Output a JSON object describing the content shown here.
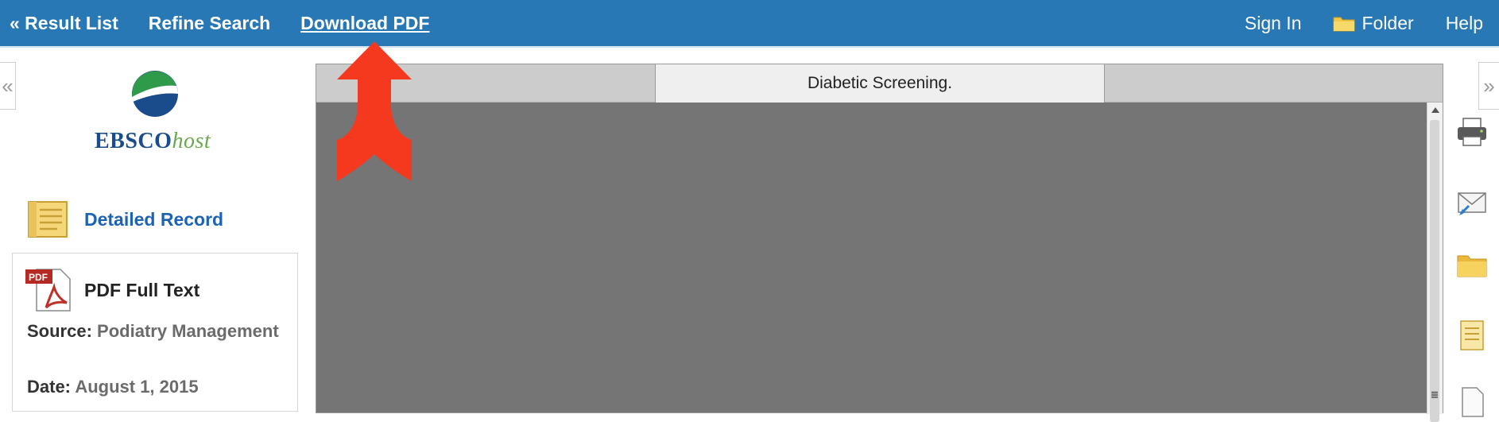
{
  "topbar": {
    "result_list": "« Result List",
    "refine_search": "Refine Search",
    "download_pdf": "Download PDF",
    "sign_in": "Sign In",
    "folder": "Folder",
    "help": "Help"
  },
  "collapse": {
    "left": "«",
    "right": "»"
  },
  "logo": {
    "brand_main": "EBSCO",
    "brand_host": "host"
  },
  "left_panel": {
    "detailed_record": "Detailed Record",
    "pdf_full_text": "PDF Full Text",
    "source_label": "Source:",
    "source_value": "Podiatry Management",
    "date_label": "Date:",
    "date_value": "August 1, 2015"
  },
  "viewer": {
    "tab_title": "Diabetic Screening."
  },
  "right_tools": [
    "print-icon",
    "email-icon",
    "folder-icon",
    "cite-icon",
    "export-icon"
  ],
  "colors": {
    "topbar": "#2878b5",
    "link_blue": "#1d63b3",
    "viewer_bg": "#757575",
    "annotation_arrow": "#f5391f"
  }
}
